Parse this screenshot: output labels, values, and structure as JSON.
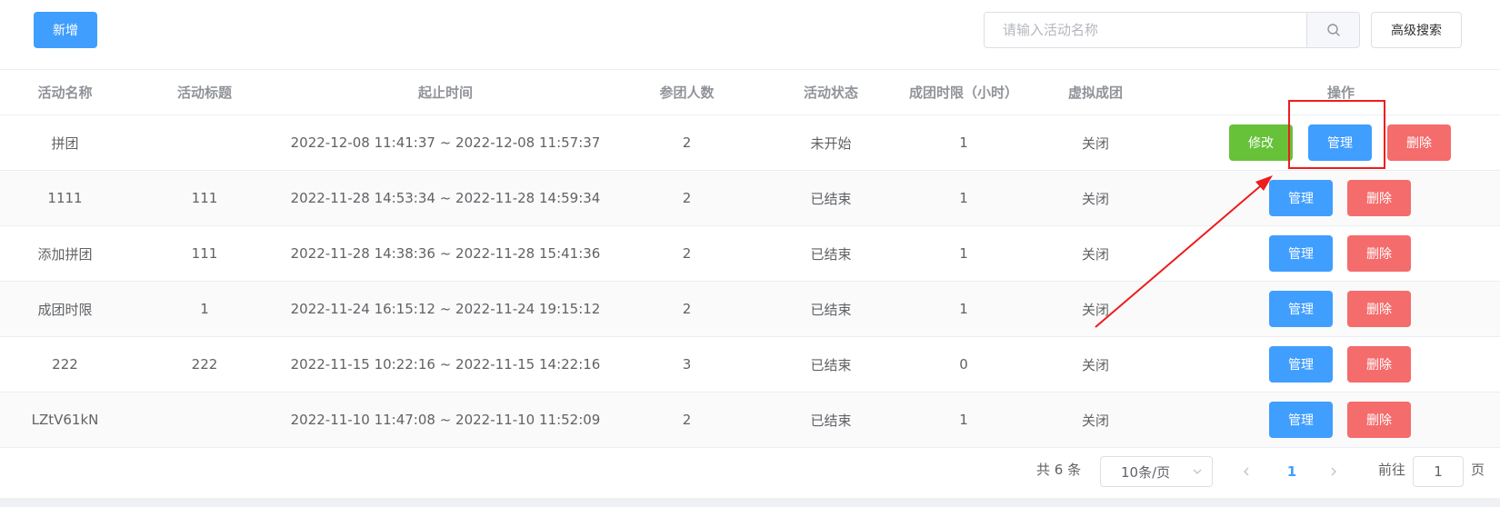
{
  "toolbar": {
    "add_label": "新增",
    "search_placeholder": "请输入活动名称",
    "advanced_search_label": "高级搜索"
  },
  "table": {
    "columns": [
      "活动名称",
      "活动标题",
      "起止时间",
      "参团人数",
      "活动状态",
      "成团时限（小时）",
      "虚拟成团",
      "操作"
    ],
    "rows": [
      {
        "name": "拼团",
        "title": "",
        "time": "2022-12-08 11:41:37 ~ 2022-12-08 11:57:37",
        "count": "2",
        "status": "未开始",
        "limit": "1",
        "virtual": "关闭",
        "edit": "修改",
        "manage": "管理",
        "delete": "删除"
      },
      {
        "name": "1111",
        "title": "111",
        "time": "2022-11-28 14:53:34 ~ 2022-11-28 14:59:34",
        "count": "2",
        "status": "已结束",
        "limit": "1",
        "virtual": "关闭",
        "manage": "管理",
        "delete": "删除"
      },
      {
        "name": "添加拼团",
        "title": "111",
        "time": "2022-11-28 14:38:36 ~ 2022-11-28 15:41:36",
        "count": "2",
        "status": "已结束",
        "limit": "1",
        "virtual": "关闭",
        "manage": "管理",
        "delete": "删除"
      },
      {
        "name": "成团时限",
        "title": "1",
        "time": "2022-11-24 16:15:12 ~ 2022-11-24 19:15:12",
        "count": "2",
        "status": "已结束",
        "limit": "1",
        "virtual": "关闭",
        "manage": "管理",
        "delete": "删除"
      },
      {
        "name": "222",
        "title": "222",
        "time": "2022-11-15 10:22:16 ~ 2022-11-15 14:22:16",
        "count": "3",
        "status": "已结束",
        "limit": "0",
        "virtual": "关闭",
        "manage": "管理",
        "delete": "删除"
      },
      {
        "name": "LZtV61kN",
        "title": "",
        "time": "2022-11-10 11:47:08 ~ 2022-11-10 11:52:09",
        "count": "2",
        "status": "已结束",
        "limit": "1",
        "virtual": "关闭",
        "manage": "管理",
        "delete": "删除"
      }
    ]
  },
  "pagination": {
    "total_label": "共 6 条",
    "page_size_label": "10条/页",
    "current_page": "1",
    "goto_prefix": "前往",
    "goto_value": "1",
    "goto_suffix": "页"
  },
  "colors": {
    "primary": "#409eff",
    "success": "#67c23a",
    "danger": "#f56c6c",
    "annotation": "#ee1c1c"
  },
  "icons": {
    "search": "search-icon",
    "select_arrow": "chevron-down-icon",
    "prev": "chevron-left-icon",
    "next": "chevron-right-icon"
  }
}
